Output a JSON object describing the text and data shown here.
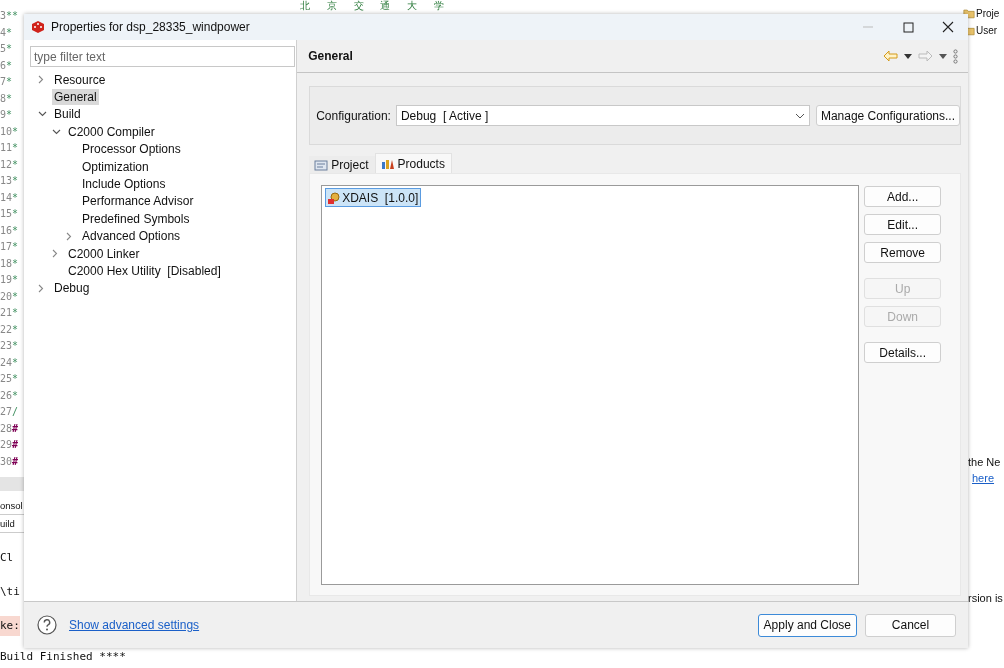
{
  "background": {
    "heading_text": "北 京 交 通 大 学",
    "editor_lines": [
      {
        "number": "3",
        "mark": "**",
        "kind": "comment"
      },
      {
        "number": "4",
        "mark": "*",
        "kind": "comment"
      },
      {
        "number": "5",
        "mark": "*",
        "kind": "comment"
      },
      {
        "number": "6",
        "mark": "*",
        "kind": "comment"
      },
      {
        "number": "7",
        "mark": "*",
        "kind": "comment"
      },
      {
        "number": "8",
        "mark": "*",
        "kind": "comment"
      },
      {
        "number": "9",
        "mark": "*",
        "kind": "comment"
      },
      {
        "number": "10",
        "mark": "*",
        "kind": "comment"
      },
      {
        "number": "11",
        "mark": "*",
        "kind": "comment"
      },
      {
        "number": "12",
        "mark": "*",
        "kind": "comment"
      },
      {
        "number": "13",
        "mark": "*",
        "kind": "comment"
      },
      {
        "number": "14",
        "mark": "*",
        "kind": "comment"
      },
      {
        "number": "15",
        "mark": "*",
        "kind": "comment"
      },
      {
        "number": "16",
        "mark": "*",
        "kind": "comment"
      },
      {
        "number": "17",
        "mark": "*",
        "kind": "comment"
      },
      {
        "number": "18",
        "mark": "*",
        "kind": "comment"
      },
      {
        "number": "19",
        "mark": "*",
        "kind": "comment"
      },
      {
        "number": "20",
        "mark": "*",
        "kind": "comment"
      },
      {
        "number": "21",
        "mark": "*",
        "kind": "comment"
      },
      {
        "number": "22",
        "mark": "*",
        "kind": "comment"
      },
      {
        "number": "23",
        "mark": "*",
        "kind": "comment"
      },
      {
        "number": "24",
        "mark": "*",
        "kind": "comment"
      },
      {
        "number": "25",
        "mark": "*",
        "kind": "comment"
      },
      {
        "number": "26",
        "mark": "*",
        "kind": "comment"
      },
      {
        "number": "27",
        "mark": "/",
        "kind": "comment"
      },
      {
        "number": "28",
        "mark": "#",
        "kind": "directive"
      },
      {
        "number": "29",
        "mark": "#",
        "kind": "directive"
      },
      {
        "number": "30",
        "mark": "#",
        "kind": "directive"
      }
    ],
    "console": {
      "tabs": [
        "onsol",
        "uild"
      ],
      "lines": [
        {
          "text": "Cl",
          "highlighted": false
        },
        {
          "text": "\\ti",
          "highlighted": false
        },
        {
          "text": "ke:",
          "highlighted": true
        },
        {
          "text": "Build Finished ****",
          "highlighted": false
        }
      ]
    },
    "explorer": [
      "Proje",
      "User"
    ],
    "notes": [
      {
        "kind": "text",
        "text": "the Ne"
      },
      {
        "kind": "link",
        "text": "here"
      },
      {
        "kind": "text",
        "text": "rsion is"
      }
    ]
  },
  "dialog": {
    "title": "Properties for dsp_28335_windpower",
    "filter": {
      "placeholder": "type filter text"
    },
    "tree": [
      {
        "label": "Resource",
        "selected": false,
        "expanded": false
      },
      {
        "label": "General",
        "selected": true
      },
      {
        "label": "Build",
        "selected": false,
        "expanded": true,
        "children": [
          {
            "label": "C2000 Compiler",
            "selected": false,
            "expanded": true,
            "children": [
              {
                "label": "Processor Options",
                "selected": false
              },
              {
                "label": "Optimization",
                "selected": false
              },
              {
                "label": "Include Options",
                "selected": false
              },
              {
                "label": "Performance Advisor",
                "selected": false
              },
              {
                "label": "Predefined Symbols",
                "selected": false
              },
              {
                "label": "Advanced Options",
                "selected": false,
                "expanded": false
              }
            ]
          },
          {
            "label": "C2000 Linker",
            "selected": false,
            "expanded": false
          },
          {
            "label": "C2000 Hex Utility  [Disabled]",
            "selected": false
          }
        ]
      },
      {
        "label": "Debug",
        "selected": false,
        "expanded": false
      }
    ],
    "page": {
      "title": "General",
      "configuration": {
        "label": "Configuration:",
        "value": "Debug  [ Active ]",
        "button": "Manage Configurations..."
      },
      "tabs": [
        {
          "label": "Project",
          "selected": false
        },
        {
          "label": "Products",
          "selected": true
        }
      ],
      "products": [
        {
          "label": "XDAIS  [1.0.0]",
          "selected": true
        }
      ],
      "buttons": [
        {
          "label": "Add...",
          "disabled": false
        },
        {
          "label": "Edit...",
          "disabled": false
        },
        {
          "label": "Remove",
          "disabled": false
        },
        {
          "label": "Up",
          "disabled": true
        },
        {
          "label": "Down",
          "disabled": true
        },
        {
          "label": "Details...",
          "disabled": false
        }
      ]
    },
    "footer": {
      "help_link": "Show advanced settings",
      "buttons": [
        {
          "label": "Apply and Close",
          "default": true
        },
        {
          "label": "Cancel",
          "default": false
        }
      ]
    }
  }
}
